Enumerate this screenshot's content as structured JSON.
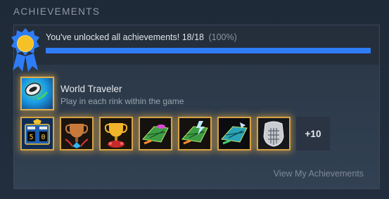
{
  "section": {
    "title": "ACHIEVEMENTS"
  },
  "progress": {
    "summary_text": "You've unlocked all achievements! 18/18",
    "percent_text": "(100%)",
    "fraction": 1.0,
    "bar_color": "#2f7df6"
  },
  "featured": {
    "name": "World Traveler",
    "description": "Play in each rink within the game",
    "icon": "globe-puck-icon"
  },
  "icons": [
    {
      "icon": "scoreboard-icon"
    },
    {
      "icon": "bronze-trophy-icon"
    },
    {
      "icon": "gold-trophy-icon"
    },
    {
      "icon": "hockey-net-icon"
    },
    {
      "icon": "hockey-net-lightning-icon"
    },
    {
      "icon": "hockey-net-blue-icon"
    },
    {
      "icon": "goalie-mask-icon"
    }
  ],
  "more_count": "+10",
  "view_link": "View My Achievements",
  "colors": {
    "gold_glow": "#e0b04e",
    "accent": "#2f7df6"
  }
}
